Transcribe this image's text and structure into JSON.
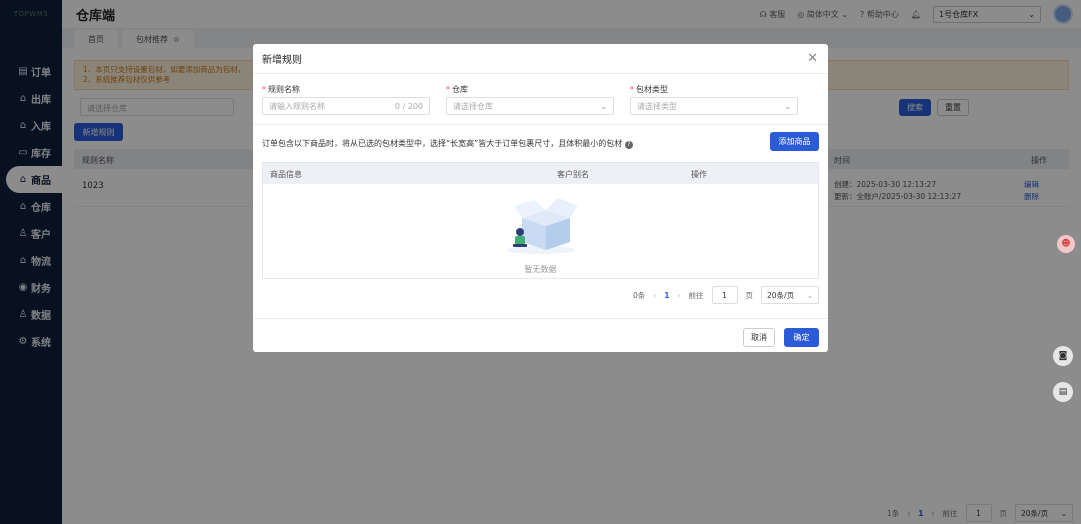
{
  "app": {
    "logo": "TOPWMS",
    "title": "仓库端"
  },
  "header": {
    "support": "客服",
    "language": "简体中文",
    "help": "帮助中心",
    "warehouse_select": "1号仓库FX"
  },
  "sidebar": {
    "items": [
      {
        "icon": "▤",
        "label": "订单"
      },
      {
        "icon": "⌂",
        "label": "出库"
      },
      {
        "icon": "⌂",
        "label": "入库"
      },
      {
        "icon": "▭",
        "label": "库存"
      },
      {
        "icon": "⌂",
        "label": "商品"
      },
      {
        "icon": "⌂",
        "label": "仓库"
      },
      {
        "icon": "♙",
        "label": "客户"
      },
      {
        "icon": "⌂",
        "label": "物流"
      },
      {
        "icon": "◉",
        "label": "财务"
      },
      {
        "icon": "♙",
        "label": "数据"
      },
      {
        "icon": "⚙",
        "label": "系统"
      }
    ]
  },
  "tabs": [
    {
      "label": "首页"
    },
    {
      "label": "包材推荐"
    }
  ],
  "page": {
    "notice_line1": "1、本页只支持设置包材，如要添加商品为包材，",
    "notice_line2": "2、系统推荐包材仅供参考",
    "warehouse_placeholder": "请选择仓库",
    "search_label": "搜索",
    "reset_label": "重置",
    "add_rule_label": "新增规则",
    "columns": {
      "rule_name": "规则名称",
      "time": "时间",
      "actions": "操作"
    },
    "row": {
      "rule_name": "1023",
      "created": "创建：2025-03-30 12:13:27",
      "updated": "更新：全账户/2025-03-30 12:13:27",
      "edit": "编辑",
      "delete": "删除"
    },
    "pager": {
      "total": "1条",
      "current": "1",
      "goto": "前往",
      "page_input": "1",
      "page_unit": "页",
      "size": "20条/页"
    }
  },
  "modal": {
    "title": "新增规则",
    "rule_name_label": "规则名称",
    "rule_name_placeholder": "请输入规则名称",
    "rule_name_count": "0 / 200",
    "warehouse_label": "仓库",
    "warehouse_placeholder": "请选择仓库",
    "material_type_label": "包材类型",
    "material_type_placeholder": "请选择类型",
    "hint": "订单包含以下商品时，将从已选的包材类型中，选择“长宽高”皆大于订单包裹尺寸，且体积最小的包材",
    "add_goods_label": "添加商品",
    "columns": {
      "goods_info": "商品信息",
      "customer_alias": "客户别名",
      "actions": "操作"
    },
    "empty_text": "暂无数据",
    "pager": {
      "total": "0条",
      "current": "1",
      "goto": "前往",
      "page_input": "1",
      "page_unit": "页",
      "size": "20条/页"
    },
    "cancel_label": "取消",
    "confirm_label": "确定"
  },
  "colors": {
    "primary": "#2b5bd7",
    "sidebar": "#0f1f3a",
    "notice_bg": "#fdf0dc",
    "required": "#e84d4d"
  }
}
